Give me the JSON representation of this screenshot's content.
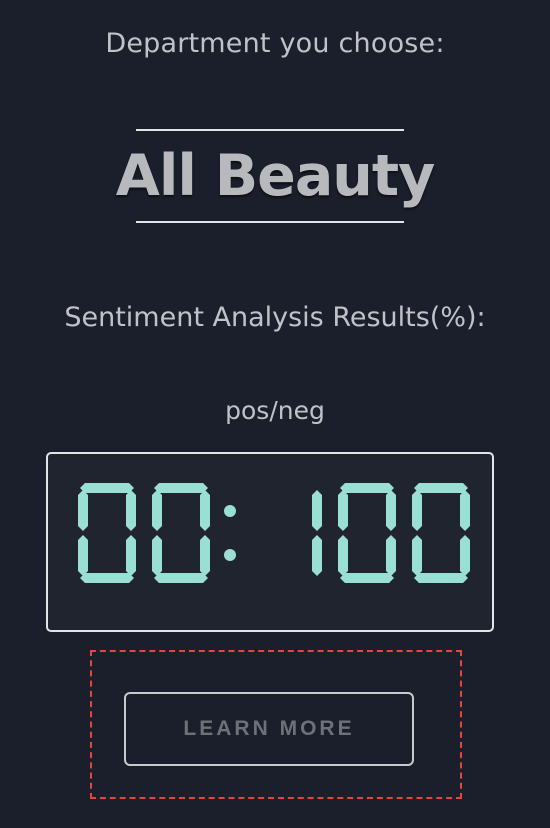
{
  "department": {
    "label": "Department you choose:",
    "name": "All Beauty"
  },
  "sentiment": {
    "label": "Sentiment Analysis Results(%):",
    "ratio_label": "pos/neg",
    "positive": "00",
    "negative": "100",
    "display_text": "00: 100",
    "digit_color": "#9adfd3"
  },
  "actions": {
    "learn_more_label": "LEARN MORE"
  },
  "colors": {
    "background": "#1b1f2b",
    "dashed_border": "#e2473c"
  }
}
